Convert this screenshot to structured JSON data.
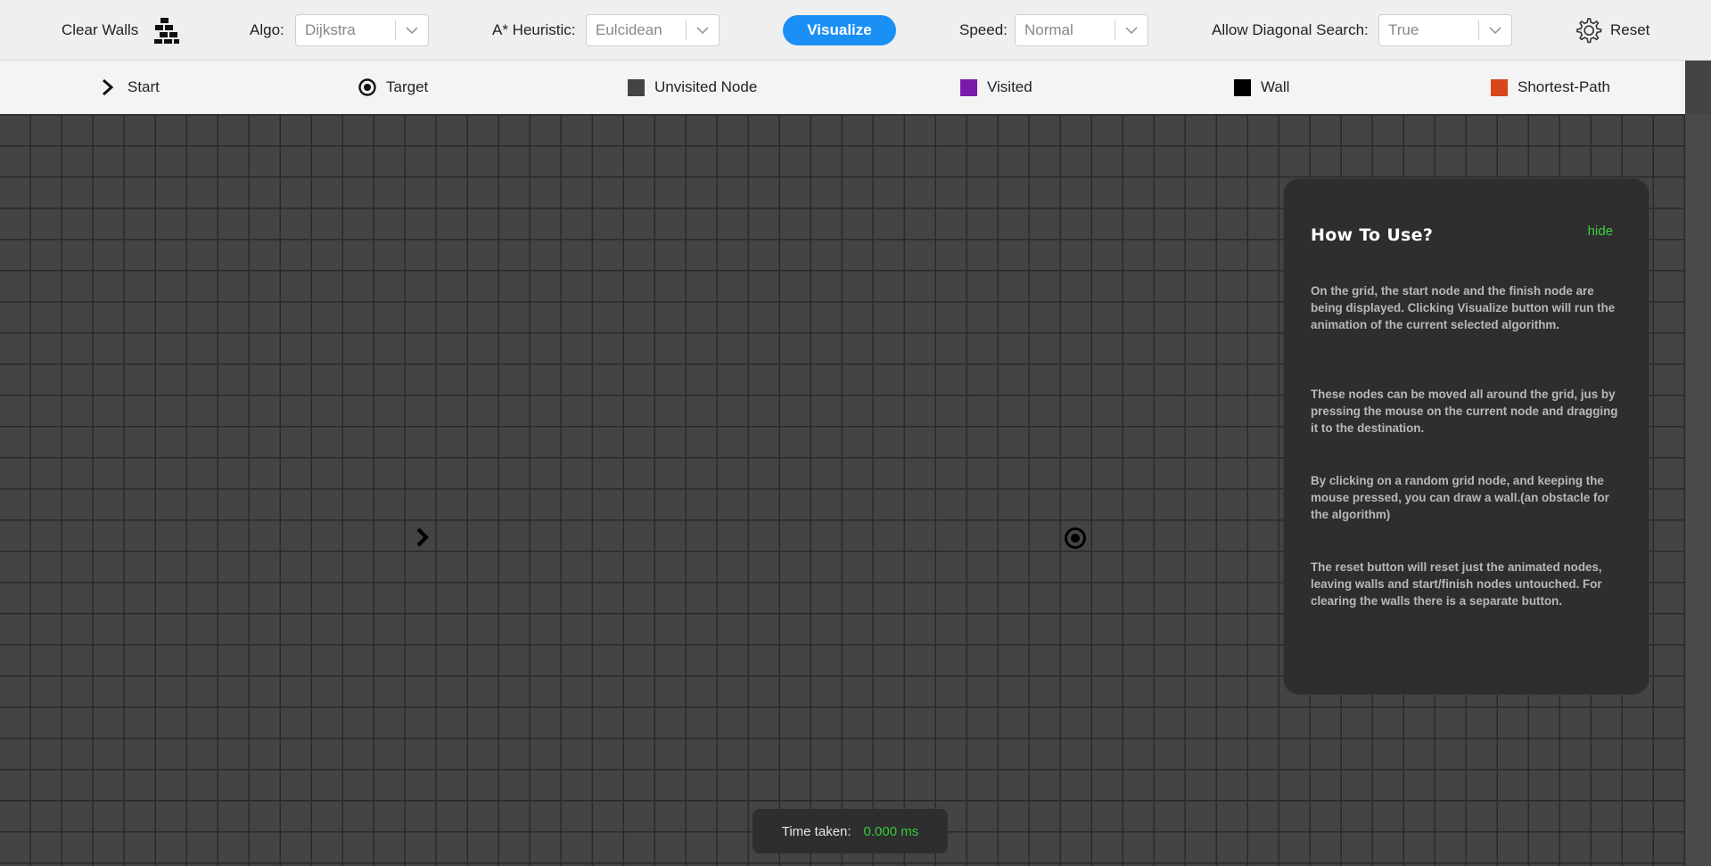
{
  "toolbar": {
    "clear_walls_label": "Clear Walls",
    "algo_label": "Algo:",
    "algo_value": "Dijkstra",
    "heuristic_label": "A* Heuristic:",
    "heuristic_value": "Eulcidean",
    "visualize_label": "Visualize",
    "speed_label": "Speed:",
    "speed_value": "Normal",
    "diagonal_label": "Allow Diagonal Search:",
    "diagonal_value": "True",
    "reset_label": "Reset",
    "accent_color": "#1a8ff5"
  },
  "legend": {
    "start": "Start",
    "target": "Target",
    "unvisited": "Unvisited Node",
    "visited": "Visited",
    "wall": "Wall",
    "shortest": "Shortest-Path",
    "colors": {
      "unvisited": "#444444",
      "visited": "#7a1aaa",
      "wall": "#000000",
      "shortest": "#d9461a"
    }
  },
  "panel": {
    "title": "How To Use?",
    "hide_label": "hide",
    "paragraphs": [
      "On the grid, the start node and the finish node are being displayed. Clicking Visualize button will run the animation of the current selected algorithm.",
      "These nodes can be moved all around the grid, jus by pressing the mouse on the current node and dragging it to the destination.",
      "By clicking on a random grid node, and keeping the mouse pressed, you can draw a wall.(an obstacle for the algorithm)",
      "The reset button will reset just the animated nodes, leaving walls and start/finish nodes untouched. For clearing the walls there is a separate button."
    ]
  },
  "status": {
    "time_label": "Time taken:",
    "time_value": "0.000 ms"
  },
  "icons": {
    "clear_walls": "brick-wall-icon",
    "reset": "gear-icon",
    "start": "chevron-right-icon",
    "target": "target-icon"
  }
}
